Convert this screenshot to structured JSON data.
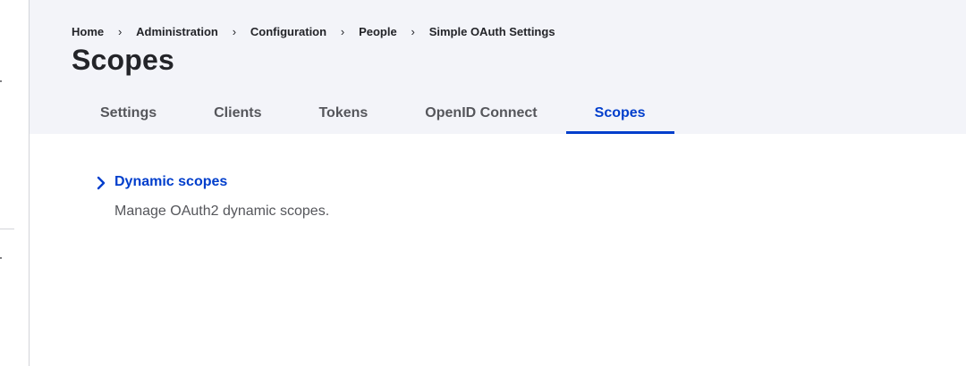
{
  "breadcrumb": {
    "items": [
      "Home",
      "Administration",
      "Configuration",
      "People",
      "Simple OAuth Settings"
    ],
    "separator": "›"
  },
  "page": {
    "title": "Scopes"
  },
  "tabs": [
    {
      "label": "Settings",
      "active": false
    },
    {
      "label": "Clients",
      "active": false
    },
    {
      "label": "Tokens",
      "active": false
    },
    {
      "label": "OpenID Connect",
      "active": false
    },
    {
      "label": "Scopes",
      "active": true
    }
  ],
  "admin_list": {
    "items": [
      {
        "title": "Dynamic scopes",
        "description": "Manage OAuth2 dynamic scopes.",
        "icon": "chevron-right-icon"
      }
    ]
  },
  "colors": {
    "accent": "#003ecc",
    "header_bg": "#f3f4f9",
    "text": "#232429",
    "muted": "#55565b"
  }
}
